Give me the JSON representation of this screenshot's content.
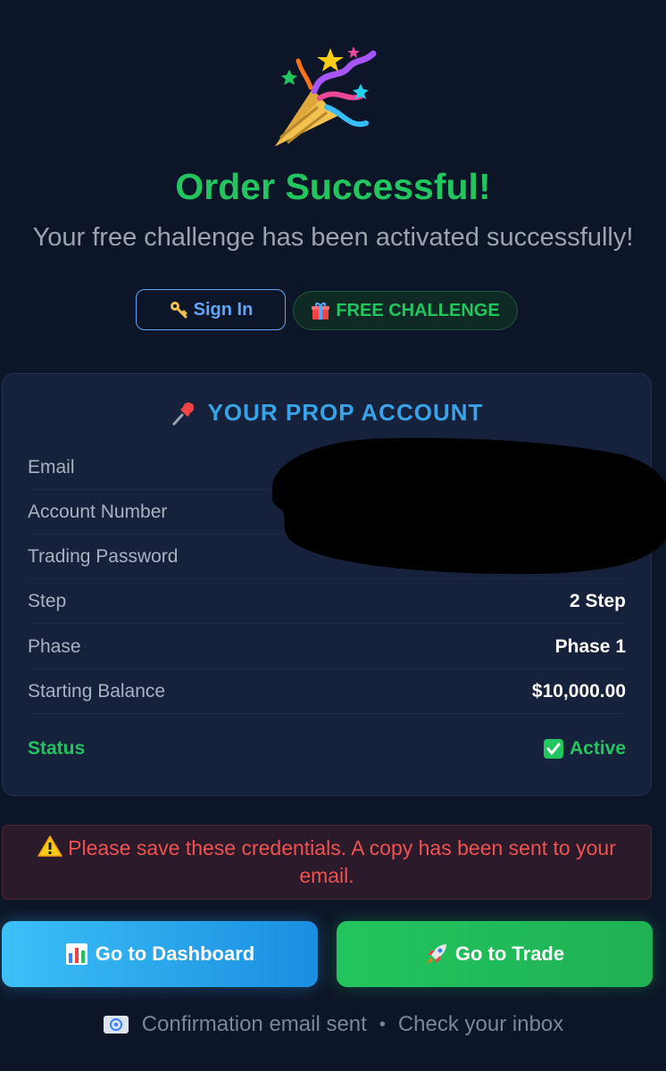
{
  "header": {
    "title": "Order Successful!",
    "subtitle": "Your free challenge has been activated successfully!",
    "icon": "party-popper-icon"
  },
  "actions": {
    "signin_label": "Sign In",
    "signin_icon": "key-icon",
    "free_label": "FREE CHALLENGE",
    "free_icon": "gift-icon"
  },
  "account": {
    "title": "YOUR PROP ACCOUNT",
    "title_icon": "pushpin-icon",
    "rows": [
      {
        "label": "Email",
        "value": ""
      },
      {
        "label": "Account Number",
        "value": ""
      },
      {
        "label": "Trading Password",
        "value": ""
      },
      {
        "label": "Step",
        "value": "2 Step"
      },
      {
        "label": "Phase",
        "value": "Phase 1"
      },
      {
        "label": "Starting Balance",
        "value": "$10,000.00"
      }
    ],
    "status": {
      "label": "Status",
      "value": "Active",
      "icon": "check-mark-icon"
    }
  },
  "warning": {
    "icon": "warning-icon",
    "text": "Please save these credentials. A copy has been sent to your email."
  },
  "buttons": {
    "dashboard_label": "Go to Dashboard",
    "dashboard_icon": "bar-chart-icon",
    "trade_label": "Go to Trade",
    "trade_icon": "rocket-icon"
  },
  "footer": {
    "icon": "email-icon",
    "sent_text": "Confirmation email sent",
    "separator": "•",
    "inbox_text": "Check your inbox"
  },
  "colors": {
    "background": "#0d1628",
    "success": "#22c55e",
    "accent_blue": "#38a3e8",
    "danger": "#f05252"
  }
}
